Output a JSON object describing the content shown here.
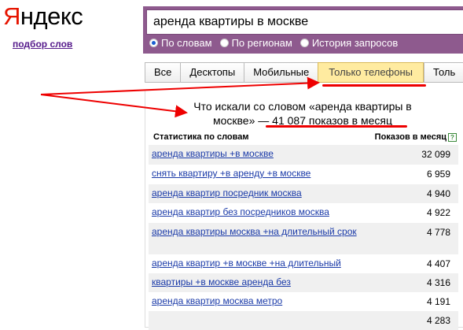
{
  "logo": {
    "first_letter": "Я",
    "rest": "ндекс",
    "tagline": "подбор слов"
  },
  "search": {
    "query": "аренда квартиры в москве"
  },
  "radio_options": [
    {
      "label": "По словам",
      "selected": true
    },
    {
      "label": "По регионам",
      "selected": false
    },
    {
      "label": "История запросов",
      "selected": false
    }
  ],
  "tabs": [
    "Все",
    "Десктопы",
    "Мобильные",
    "Только телефоны",
    "Толь"
  ],
  "active_tab": "Только телефоны",
  "headline": {
    "line1": "Что искали со словом «аренда квартиры в",
    "line2_start": "москве» — ",
    "line2_highlight": "41 087 показов в месяц"
  },
  "table": {
    "col_query": "Статистика по словам",
    "col_count": "Показов в месяц",
    "help": "?",
    "rows": [
      {
        "q": "аренда квартиры +в москве",
        "n": "32 099"
      },
      {
        "q": "снять квартиру +в аренду +в москве",
        "n": "6 959"
      },
      {
        "q": "аренда квартир посредник москва",
        "n": "4 940"
      },
      {
        "q": "аренда квартир без посредников москва",
        "n": "4 922"
      },
      {
        "q": "аренда квартиры москва +на длительный срок",
        "n": "4 778"
      },
      {
        "q": "аренда квартир +в москве +на длительный",
        "n": "4 407"
      },
      {
        "q": "квартиры +в москве аренда без",
        "n": "4 316"
      },
      {
        "q": "аренда квартир москва метро",
        "n": "4 191"
      },
      {
        "q": "",
        "n": "4 283"
      }
    ]
  },
  "colors": {
    "accent": "#e00000",
    "search_frame": "#8e5a8e",
    "link": "#1a3aa8",
    "active_tab": "#ffeba0"
  }
}
